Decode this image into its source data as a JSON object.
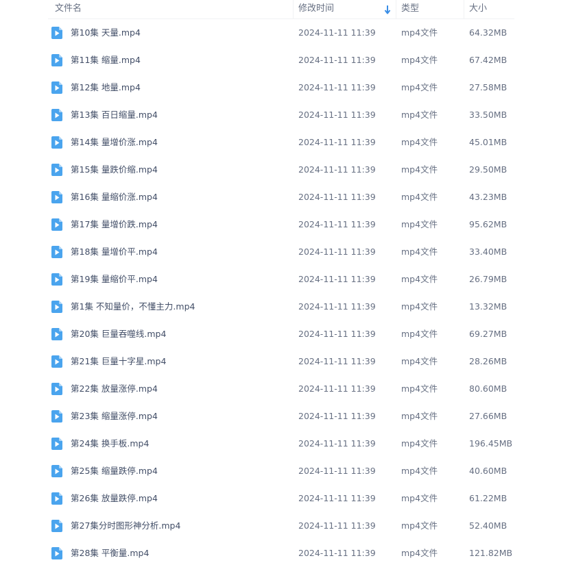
{
  "header": {
    "name_label": "文件名",
    "time_label": "修改时间",
    "type_label": "类型",
    "size_label": "大小"
  },
  "colors": {
    "icon_blue": "#4aa4ee",
    "icon_fold": "#a8d3f7",
    "sort_arrow": "#3a8ee6"
  },
  "files": [
    {
      "name": "第10集 天量.mp4",
      "modified": "2024-11-11 11:39",
      "type": "mp4文件",
      "size": "64.32MB"
    },
    {
      "name": "第11集 缩量.mp4",
      "modified": "2024-11-11 11:39",
      "type": "mp4文件",
      "size": "67.42MB"
    },
    {
      "name": "第12集 地量.mp4",
      "modified": "2024-11-11 11:39",
      "type": "mp4文件",
      "size": "27.58MB"
    },
    {
      "name": "第13集 百日缩量.mp4",
      "modified": "2024-11-11 11:39",
      "type": "mp4文件",
      "size": "33.50MB"
    },
    {
      "name": "第14集 量增价涨.mp4",
      "modified": "2024-11-11 11:39",
      "type": "mp4文件",
      "size": "45.01MB"
    },
    {
      "name": "第15集 量跌价缩.mp4",
      "modified": "2024-11-11 11:39",
      "type": "mp4文件",
      "size": "29.50MB"
    },
    {
      "name": "第16集 量缩价涨.mp4",
      "modified": "2024-11-11 11:39",
      "type": "mp4文件",
      "size": "43.23MB"
    },
    {
      "name": "第17集 量增价跌.mp4",
      "modified": "2024-11-11 11:39",
      "type": "mp4文件",
      "size": "95.62MB"
    },
    {
      "name": "第18集 量增价平.mp4",
      "modified": "2024-11-11 11:39",
      "type": "mp4文件",
      "size": "33.40MB"
    },
    {
      "name": "第19集 量缩价平.mp4",
      "modified": "2024-11-11 11:39",
      "type": "mp4文件",
      "size": "26.79MB"
    },
    {
      "name": "第1集 不知量价，不懂主力.mp4",
      "modified": "2024-11-11 11:39",
      "type": "mp4文件",
      "size": "13.32MB"
    },
    {
      "name": "第20集 巨量吞噬线.mp4",
      "modified": "2024-11-11 11:39",
      "type": "mp4文件",
      "size": "69.27MB"
    },
    {
      "name": "第21集 巨量十字星.mp4",
      "modified": "2024-11-11 11:39",
      "type": "mp4文件",
      "size": "28.26MB"
    },
    {
      "name": "第22集 放量涨停.mp4",
      "modified": "2024-11-11 11:39",
      "type": "mp4文件",
      "size": "80.60MB"
    },
    {
      "name": "第23集 缩量涨停.mp4",
      "modified": "2024-11-11 11:39",
      "type": "mp4文件",
      "size": "27.66MB"
    },
    {
      "name": "第24集 换手板.mp4",
      "modified": "2024-11-11 11:39",
      "type": "mp4文件",
      "size": "196.45MB"
    },
    {
      "name": "第25集 缩量跌停.mp4",
      "modified": "2024-11-11 11:39",
      "type": "mp4文件",
      "size": "40.60MB"
    },
    {
      "name": "第26集 放量跌停.mp4",
      "modified": "2024-11-11 11:39",
      "type": "mp4文件",
      "size": "61.22MB"
    },
    {
      "name": "第27集分时图形神分析.mp4",
      "modified": "2024-11-11 11:39",
      "type": "mp4文件",
      "size": "52.40MB"
    },
    {
      "name": "第28集 平衡量.mp4",
      "modified": "2024-11-11 11:39",
      "type": "mp4文件",
      "size": "121.82MB"
    }
  ]
}
